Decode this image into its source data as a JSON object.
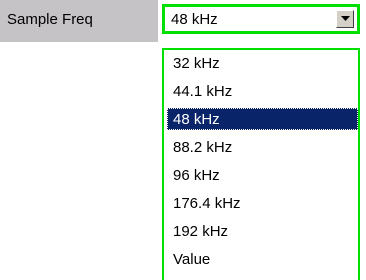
{
  "parameter": {
    "label": "Sample Freq"
  },
  "select": {
    "value": "48 kHz",
    "options": [
      "32 kHz",
      "44.1 kHz",
      "48 kHz",
      "88.2 kHz",
      "96 kHz",
      "176.4 kHz",
      "192 kHz",
      "Value"
    ],
    "selected_index": 2
  },
  "colors": {
    "focus_border": "#00e000",
    "highlight": "#0a246a",
    "label_bg": "#c6c3c6"
  },
  "icons": {
    "dropdown": "chevron-down-icon"
  }
}
